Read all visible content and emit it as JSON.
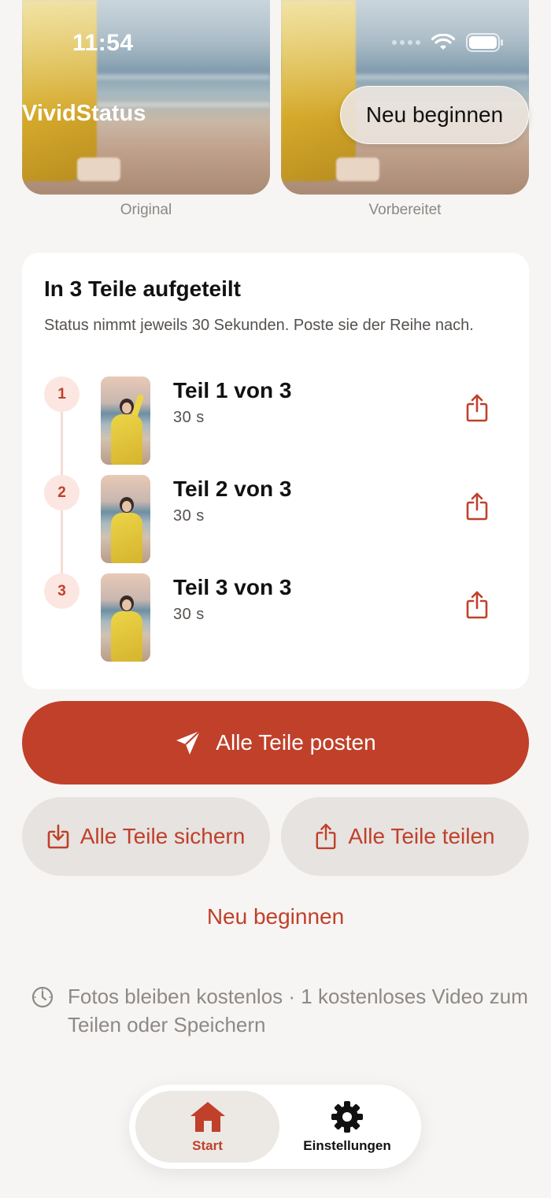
{
  "status_bar": {
    "time": "11:54"
  },
  "nav": {
    "app_title": "VividStatus",
    "restart_button": "Neu beginnen"
  },
  "previews": {
    "original_label": "Original",
    "prepared_label": "Vorbereitet"
  },
  "card": {
    "title": "In 3 Teile aufgeteilt",
    "subtitle": "Status nimmt jeweils 30 Sekunden. Poste sie der Reihe nach.",
    "parts": [
      {
        "number": "1",
        "title": "Teil 1 von 3",
        "duration": "30 s"
      },
      {
        "number": "2",
        "title": "Teil 2 von 3",
        "duration": "30 s"
      },
      {
        "number": "3",
        "title": "Teil 3 von 3",
        "duration": "30 s"
      }
    ]
  },
  "actions": {
    "post_all": "Alle Teile posten",
    "save_all": "Alle Teile sichern",
    "share_all": "Alle Teile teilen",
    "restart_link": "Neu beginnen"
  },
  "notice": "Fotos bleiben kostenlos · 1 kostenloses Video zum Teilen oder Speichern",
  "tabbar": {
    "items": [
      {
        "label": "Start",
        "icon": "home-icon",
        "active": true
      },
      {
        "label": "Einstellungen",
        "icon": "gear-icon",
        "active": false
      }
    ]
  },
  "colors": {
    "accent": "#c0402a",
    "background": "#f7f5f3",
    "card": "#ffffff",
    "secondary_button": "#e6e3e0"
  }
}
